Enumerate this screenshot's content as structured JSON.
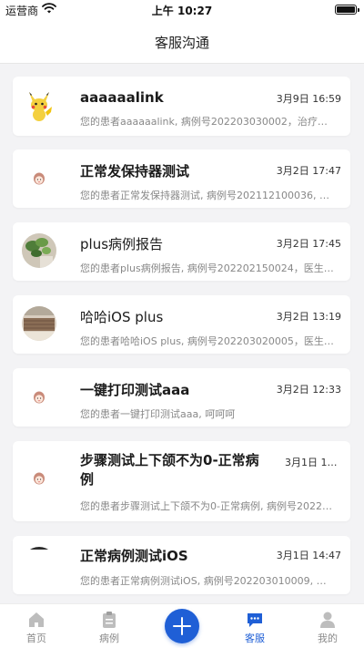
{
  "status_bar": {
    "carrier": "运营商",
    "time": "上午 10:27"
  },
  "nav": {
    "title": "客服沟通"
  },
  "conversations": [
    {
      "name": "aaaaaalink",
      "date": "3月9日 16:59",
      "preview": "您的患者aaaaaalink, 病例号202203030002，治疗已…",
      "avatar": "pikachu"
    },
    {
      "name": "正常发保持器测试",
      "date": "3月2日 17:47",
      "preview": "您的患者正常发保持器测试, 病例号202112100036, …",
      "avatar": "cartoon-girl"
    },
    {
      "name": "plus病例报告",
      "date": "3月2日 17:45",
      "preview": "您的患者plus病例报告, 病例号202202150024，医生…",
      "avatar": "plant-photo"
    },
    {
      "name": "哈哈iOS plus",
      "date": "3月2日 13:19",
      "preview": "您的患者哈哈iOS plus, 病例号202203020005，医生…",
      "avatar": "basket-photo"
    },
    {
      "name": "一键打印测试aaa",
      "date": "3月2日 12:33",
      "preview": "您的患者一键打印测试aaa, 呵呵呵",
      "avatar": "cartoon-girl"
    },
    {
      "name": "步骤测试上下颌不为0-正常病例",
      "date": "3月1日 16:…",
      "preview": "您的患者步骤测试上下颌不为0-正常病例, 病例号2022…",
      "avatar": "cartoon-girl"
    },
    {
      "name": "正常病例测试iOS",
      "date": "3月1日 14:47",
      "preview": "您的患者正常病例测试iOS, 病例号202203010009, …",
      "avatar": "dark-photo"
    }
  ],
  "tab_bar": {
    "tabs": [
      {
        "label": "首页",
        "icon": "home-icon"
      },
      {
        "label": "病例",
        "icon": "clipboard-icon"
      },
      {
        "label": "客服",
        "icon": "chat-icon",
        "active": true
      },
      {
        "label": "我的",
        "icon": "person-icon"
      }
    ],
    "add_icon": "plus-icon"
  },
  "colors": {
    "accent": "#1f5fd6",
    "background": "#f3f3f5",
    "card": "#ffffff"
  }
}
